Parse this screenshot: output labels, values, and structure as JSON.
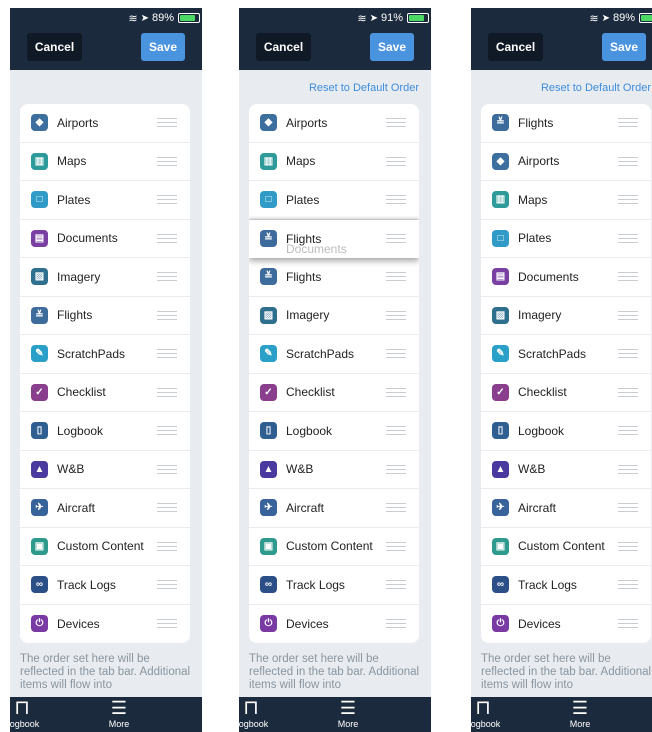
{
  "screens": [
    {
      "status": {
        "battery": "89%"
      },
      "cancel_label": "Cancel",
      "save_label": "Save",
      "reset_label": "",
      "items": [
        "Airports",
        "Maps",
        "Plates",
        "Documents",
        "Imagery",
        "Flights",
        "ScratchPads",
        "Checklist",
        "Logbook",
        "W&B",
        "Aircraft",
        "Custom Content",
        "Track Logs",
        "Devices"
      ],
      "footer": "The order set here will be reflected in the tab bar. Additional items will flow into",
      "tabs": [
        "Logbook",
        "More"
      ]
    },
    {
      "status": {
        "battery": "91%"
      },
      "cancel_label": "Cancel",
      "save_label": "Save",
      "reset_label": "Reset to Default Order",
      "items": [
        "Airports",
        "Maps",
        "Plates",
        "",
        "Flights",
        "Imagery",
        "ScratchPads",
        "Checklist",
        "Logbook",
        "W&B",
        "Aircraft",
        "Custom Content",
        "Track Logs",
        "Devices"
      ],
      "dragging": {
        "label": "Flights",
        "under_label": "Documents"
      },
      "footer": "The order set here will be reflected in the tab bar. Additional items will flow into",
      "tabs": [
        "Logbook",
        "More"
      ]
    },
    {
      "status": {
        "battery": "89%"
      },
      "cancel_label": "Cancel",
      "save_label": "Save",
      "reset_label": "Reset to Default Order",
      "items": [
        "Flights",
        "Airports",
        "Maps",
        "Plates",
        "Documents",
        "Imagery",
        "ScratchPads",
        "Checklist",
        "Logbook",
        "W&B",
        "Aircraft",
        "Custom Content",
        "Track Logs",
        "Devices"
      ],
      "footer": "The order set here will be reflected in the tab bar. Additional items will flow into",
      "tabs": [
        "Logbook",
        "More"
      ]
    }
  ],
  "icons": {
    "Airports": {
      "name": "airport-icon",
      "glyph": "◆",
      "color": "#3c6e9e"
    },
    "Maps": {
      "name": "map-icon",
      "glyph": "▥",
      "color": "#2e9a9a"
    },
    "Plates": {
      "name": "plates-icon",
      "glyph": "□",
      "color": "#2f9bc6"
    },
    "Documents": {
      "name": "documents-icon",
      "glyph": "▤",
      "color": "#7a3fa3"
    },
    "Imagery": {
      "name": "imagery-icon",
      "glyph": "▨",
      "color": "#2e6f8e"
    },
    "Flights": {
      "name": "flights-icon",
      "glyph": "≚",
      "color": "#3d6b9c"
    },
    "ScratchPads": {
      "name": "scratchpad-icon",
      "glyph": "✎",
      "color": "#2aa0c8"
    },
    "Checklist": {
      "name": "checklist-icon",
      "glyph": "✓",
      "color": "#8a3e8e"
    },
    "Logbook": {
      "name": "logbook-icon",
      "glyph": "▯",
      "color": "#2f5f91"
    },
    "W&B": {
      "name": "scale-icon",
      "glyph": "▲",
      "color": "#4a3aa0"
    },
    "Aircraft": {
      "name": "aircraft-icon",
      "glyph": "✈",
      "color": "#37629a"
    },
    "Custom Content": {
      "name": "custom-content-icon",
      "glyph": "▣",
      "color": "#2e9a8e"
    },
    "Track Logs": {
      "name": "track-logs-icon",
      "glyph": "∞",
      "color": "#2b4f86"
    },
    "Devices": {
      "name": "devices-icon",
      "glyph": "⏻",
      "color": "#7a3aa3"
    }
  }
}
